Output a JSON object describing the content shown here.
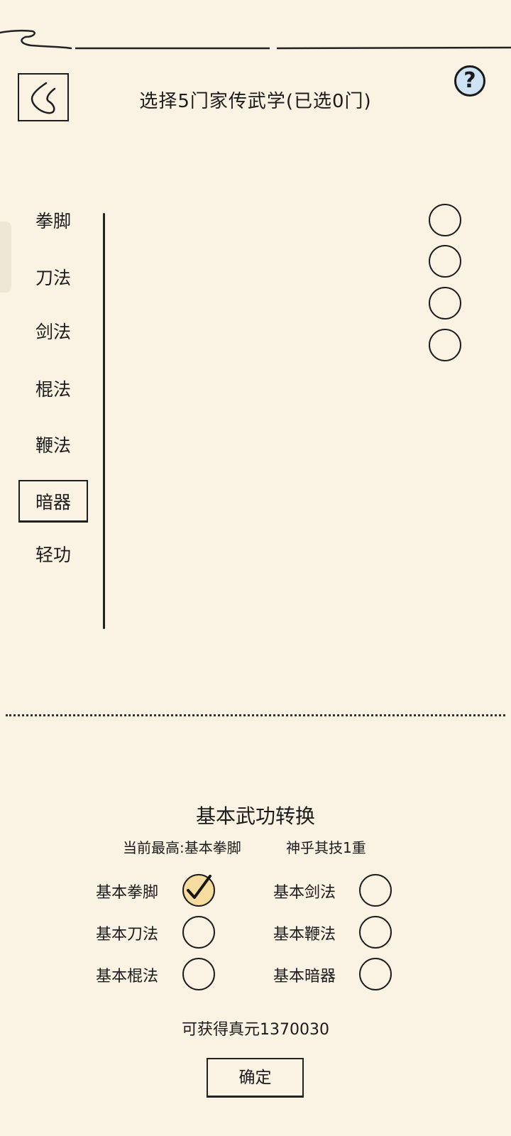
{
  "header": {
    "title": "选择5门家传武学(已选0门)",
    "help_label": "?"
  },
  "categories": [
    {
      "label": "拳脚",
      "active": false
    },
    {
      "label": "刀法",
      "active": false
    },
    {
      "label": "剑法",
      "active": false
    },
    {
      "label": "棍法",
      "active": false
    },
    {
      "label": "鞭法",
      "active": false
    },
    {
      "label": "暗器",
      "active": true
    },
    {
      "label": "轻功",
      "active": false
    }
  ],
  "skill_slots_count": 4,
  "conversion": {
    "title": "基本武功转换",
    "current_best": "当前最高:基本拳脚",
    "current_level": "神乎其技1重",
    "options": [
      {
        "label": "基本拳脚",
        "checked": true
      },
      {
        "label": "基本剑法",
        "checked": false
      },
      {
        "label": "基本刀法",
        "checked": false
      },
      {
        "label": "基本鞭法",
        "checked": false
      },
      {
        "label": "基本棍法",
        "checked": false
      },
      {
        "label": "基本暗器",
        "checked": false
      }
    ],
    "reward": "可获得真元1370030",
    "confirm_label": "确定"
  },
  "colors": {
    "background": "#faf3e3",
    "checked_fill": "#f7dca0",
    "help_fill": "#cfe3f6"
  }
}
